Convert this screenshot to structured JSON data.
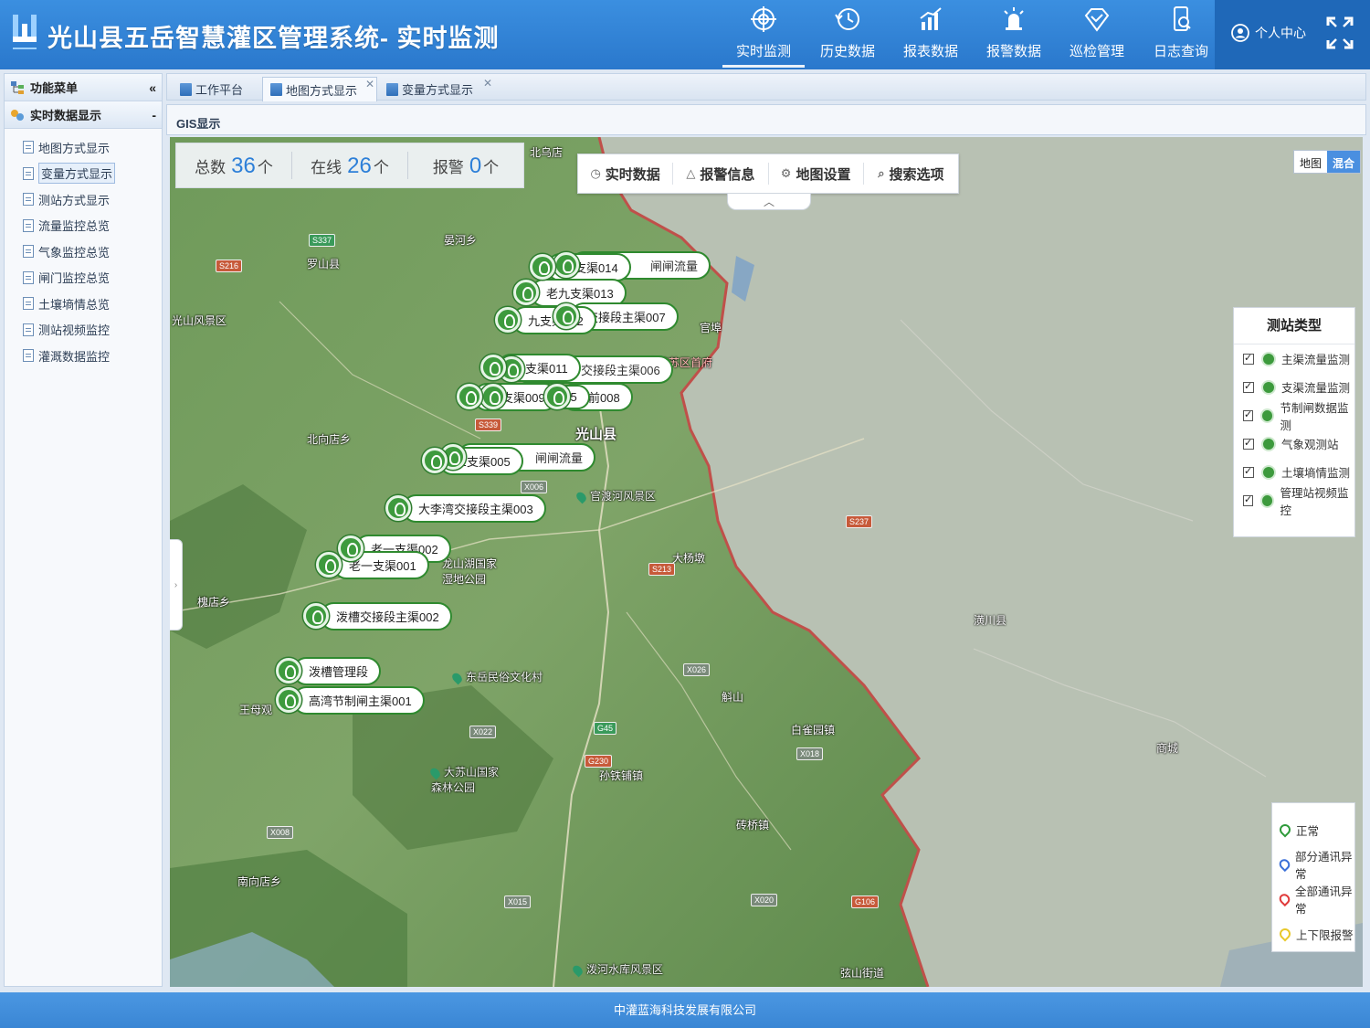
{
  "header": {
    "title": "光山县五岳智慧灌区管理系统- 实时监测",
    "nav": [
      {
        "label": "实时监测",
        "icon": "target-icon",
        "active": true
      },
      {
        "label": "历史数据",
        "icon": "history-icon",
        "active": false
      },
      {
        "label": "报表数据",
        "icon": "report-chart-icon",
        "active": false
      },
      {
        "label": "报警数据",
        "icon": "alarm-light-icon",
        "active": false
      },
      {
        "label": "巡检管理",
        "icon": "diamond-check-icon",
        "active": false
      },
      {
        "label": "日志查询",
        "icon": "log-phone-icon",
        "active": false
      }
    ],
    "user_label": "个人中心",
    "accent": "#2a78cc"
  },
  "sidebar": {
    "title": "功能菜单",
    "collapse_glyph": "«",
    "section": "实时数据显示",
    "section_toggle": "-",
    "items": [
      {
        "label": "地图方式显示"
      },
      {
        "label": "变量方式显示",
        "selected": true
      },
      {
        "label": "测站方式显示"
      },
      {
        "label": "流量监控总览"
      },
      {
        "label": "气象监控总览"
      },
      {
        "label": "闸门监控总览"
      },
      {
        "label": "土壤墒情总览"
      },
      {
        "label": "测站视频监控"
      },
      {
        "label": "灌溉数据监控"
      }
    ]
  },
  "tabs": [
    {
      "label": "工作平台",
      "closable": false
    },
    {
      "label": "地图方式显示",
      "closable": true,
      "active": true
    },
    {
      "label": "变量方式显示",
      "closable": true
    }
  ],
  "panel_title": "GIS显示",
  "stats": {
    "total_label": "总数",
    "total_value": "36",
    "total_unit": "个",
    "online_label": "在线",
    "online_value": "26",
    "online_unit": "个",
    "alarm_label": "报警",
    "alarm_value": "0",
    "alarm_unit": "个"
  },
  "map_toolbar": [
    "实时数据",
    "报警信息",
    "地图设置",
    "搜索选项"
  ],
  "map_types": [
    "地图",
    "混合"
  ],
  "legend_type": {
    "title": "测站类型",
    "items": [
      "主渠流量监测",
      "支渠流量监测",
      "节制闸数据监测",
      "气象观测站",
      "土壤墒情监测",
      "管理站视频监控"
    ]
  },
  "legend_status": [
    {
      "label": "正常",
      "color": "#2e9a3a"
    },
    {
      "label": "部分通讯异常",
      "color": "#3a6fd8"
    },
    {
      "label": "全部通讯异常",
      "color": "#e03a3a"
    },
    {
      "label": "上下限报警",
      "color": "#e8c82a"
    }
  ],
  "stations": [
    "闸闸流量",
    "十支渠014",
    "老九支渠013",
    "交接段主渠007",
    "九支渠012",
    "交接段主渠006",
    "北支渠011",
    "前008",
    "005",
    "六支渠009",
    "闸闸流量",
    "三支渠005",
    "大李湾交接段主渠003",
    "老一支渠002",
    "老一支渠001",
    "泼槽交接段主渠002",
    "泼槽管理段",
    "高湾节制闸主渠001"
  ],
  "places": [
    "北乌店",
    "光山县",
    "官渡河风景区",
    "龙山湖国家湿地公园",
    "东岳民俗文化村",
    "大苏山国家森林公园",
    "泼河水库风景区",
    "鄂豫皖苏区首府",
    "晏河乡",
    "光山风景区",
    "北向店乡",
    "罗山县",
    "大杨墩",
    "白雀园镇",
    "砖桥镇",
    "孙铁铺镇",
    "南向店乡",
    "王母观",
    "槐店乡",
    "商城",
    "潢川县",
    "斛山",
    "弦山街道",
    "官埠"
  ],
  "roads": [
    "S337",
    "S216",
    "G45",
    "X006",
    "S339",
    "S213",
    "X022",
    "X026",
    "G230",
    "X018",
    "X015",
    "X020",
    "G106",
    "S237",
    "X008"
  ],
  "footer": "中灌蓝海科技发展有限公司"
}
